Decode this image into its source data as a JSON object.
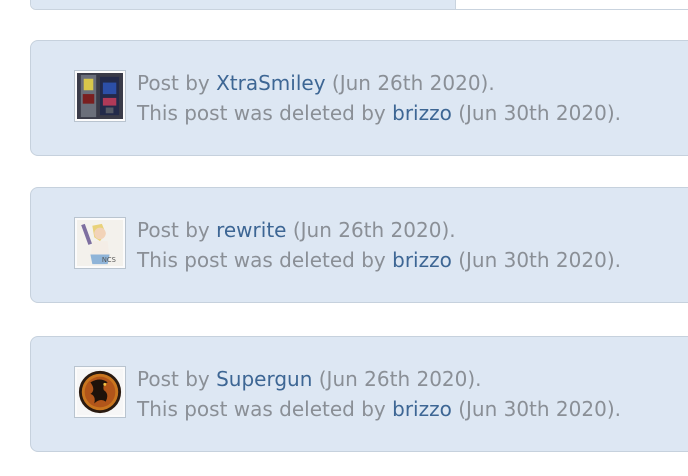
{
  "posts": [
    {
      "prefix": "Post by ",
      "author": "XtraSmiley",
      "date": " (Jun 26th 2020).",
      "deleted_prefix": "This post was deleted by ",
      "deleted_by": "brizzo",
      "deleted_date": " (Jun 30th 2020).",
      "avatar_icon": "arcade-cabinet-avatar-icon"
    },
    {
      "prefix": "Post by ",
      "author": "rewrite",
      "date": " (Jun 26th 2020).",
      "deleted_prefix": "This post was deleted by ",
      "deleted_by": "brizzo",
      "deleted_date": " (Jun 30th 2020).",
      "avatar_icon": "anime-character-avatar-icon"
    },
    {
      "prefix": "Post by ",
      "author": "Supergun",
      "date": " (Jun 26th 2020).",
      "deleted_prefix": "This post was deleted by ",
      "deleted_by": "brizzo",
      "deleted_date": " (Jun 30th 2020).",
      "avatar_icon": "mortal-kombat-dragon-avatar-icon"
    }
  ],
  "colors": {
    "panel_bg": "#dde7f3",
    "panel_border": "#c6d1dd",
    "text": "#8a8f96",
    "link": "#3d6694"
  }
}
